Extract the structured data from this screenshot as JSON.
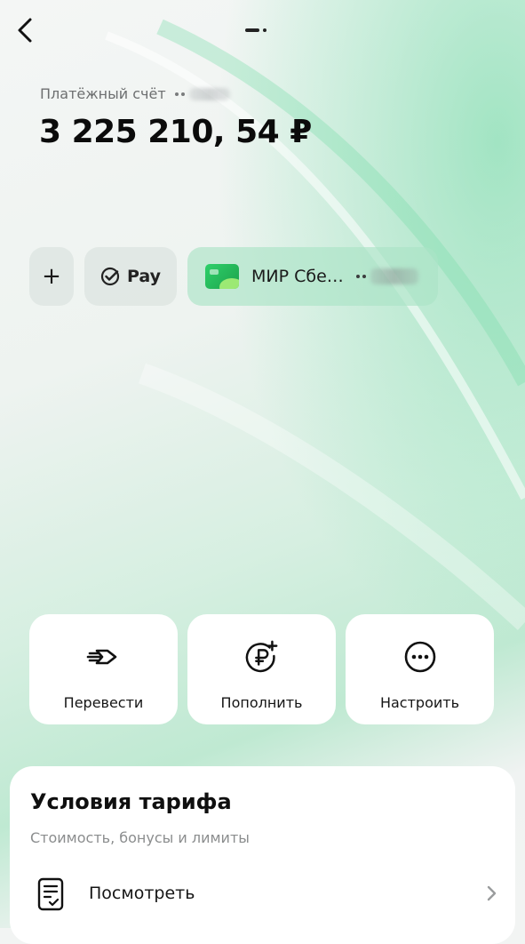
{
  "header": {
    "back_icon": "chevron-left-icon",
    "page_indicator": "page-dots"
  },
  "account": {
    "label": "Платёжный счёт",
    "balance": "3 225 210, 54 ₽"
  },
  "chips": {
    "add_label": "+",
    "pay_label": "Pay",
    "card_label": "МИР Сбе…"
  },
  "actions": [
    {
      "label": "Перевести",
      "icon": "transfer-arrow-icon"
    },
    {
      "label": "Пополнить",
      "icon": "ruble-plus-icon"
    },
    {
      "label": "Настроить",
      "icon": "more-dots-icon"
    }
  ],
  "tariff": {
    "title": "Условия тарифа",
    "subtitle": "Стоимость, бонусы и лимиты",
    "view_label": "Посмотреть"
  },
  "colors": {
    "accent_green": "#21c05f",
    "card_bg": "#ffffff",
    "text_primary": "#111111",
    "text_secondary": "#8b8d8e"
  }
}
